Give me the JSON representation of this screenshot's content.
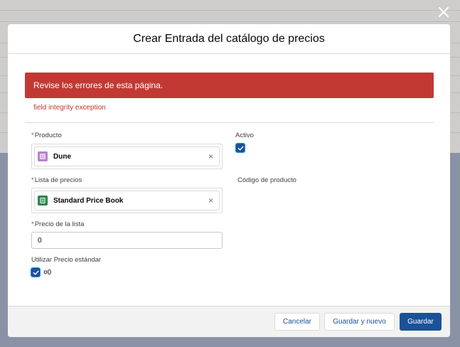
{
  "modal": {
    "title": "Crear Entrada del catálogo de precios",
    "close_icon": "close-icon"
  },
  "errors": {
    "banner": "Revise los errores de esta página.",
    "detail": "field integrity exception"
  },
  "form": {
    "required_marker": "*",
    "product": {
      "label": "Producto",
      "value": "Dune",
      "icon": "product-icon",
      "remove_glyph": "×"
    },
    "active": {
      "label": "Activo",
      "checked": true
    },
    "price_book": {
      "label": "Lista de precios",
      "value": "Standard Price Book",
      "icon": "pricebook-icon",
      "remove_glyph": "×"
    },
    "product_code": {
      "label": "Código de producto"
    },
    "list_price": {
      "label": "Precio de la lista",
      "value": "0"
    },
    "use_standard_price": {
      "label": "Utilizar Precio estándar",
      "checked": true,
      "value_text": "¤0"
    }
  },
  "footer": {
    "cancel_label": "Cancelar",
    "save_new_label": "Guardar y nuevo",
    "save_label": "Guardar"
  },
  "colors": {
    "brand": "#1b5297",
    "error": "#c23934",
    "product_icon": "#b781d3",
    "pricebook_icon": "#2e844a"
  }
}
